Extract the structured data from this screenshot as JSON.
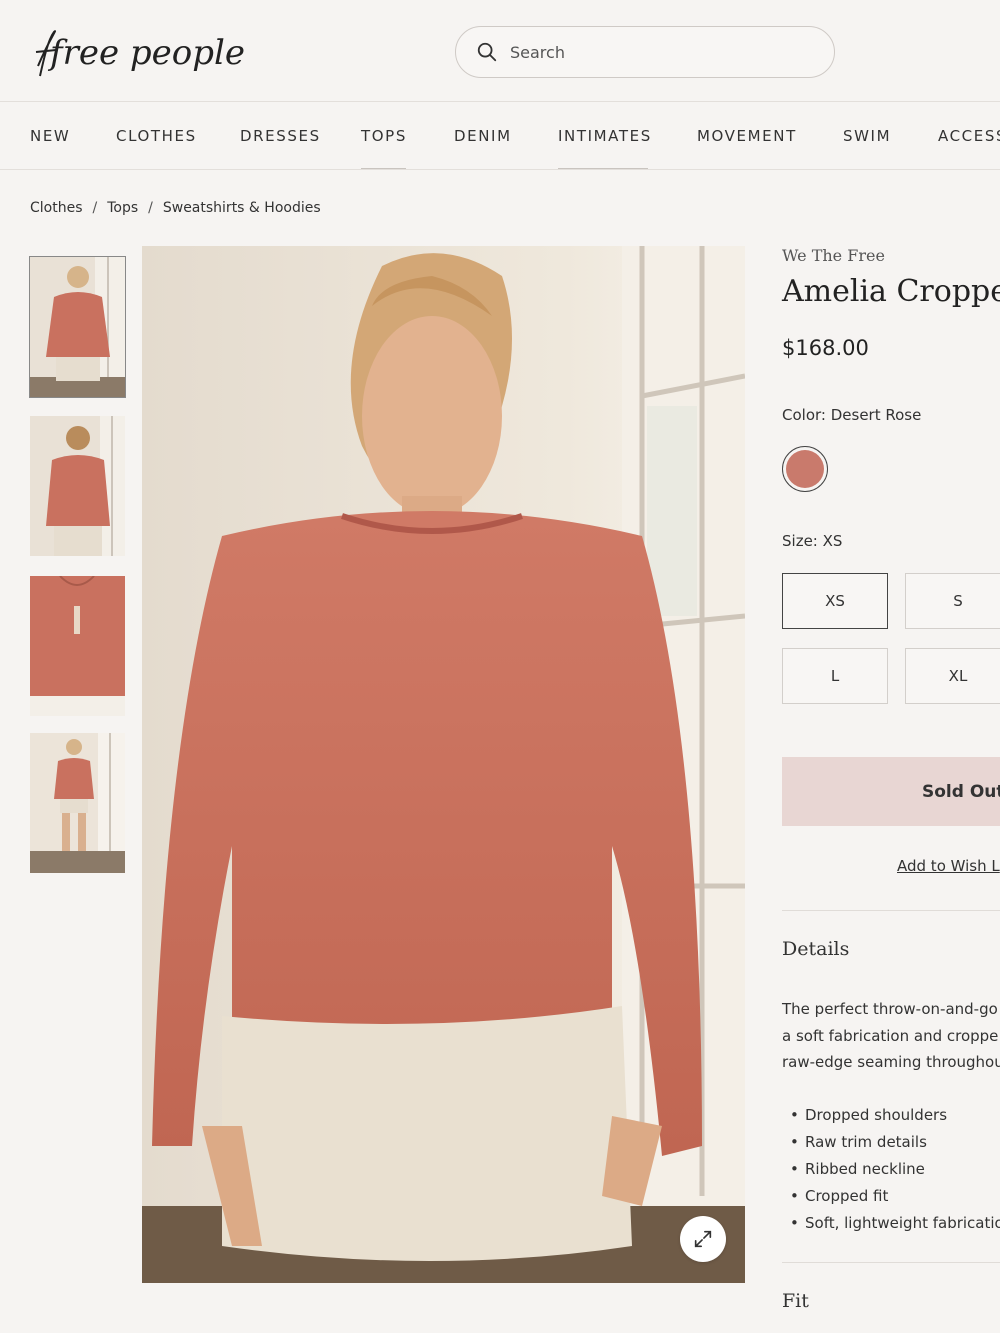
{
  "header": {
    "logo_text": "free people",
    "search_placeholder": "Search"
  },
  "nav": {
    "items": [
      "NEW",
      "CLOTHES",
      "DRESSES",
      "TOPS",
      "DENIM",
      "INTIMATES",
      "MOVEMENT",
      "SWIM",
      "ACCESS"
    ]
  },
  "breadcrumb": {
    "items": [
      "Clothes",
      "Tops",
      "Sweatshirts & Hoodies"
    ],
    "separator": "/"
  },
  "product": {
    "brand": "We The Free",
    "title": "Amelia Cropped",
    "price": "$168.00",
    "color_label": "Color: Desert Rose",
    "color_hex": "#c97a6c",
    "size_label": "Size: XS",
    "sizes": [
      "XS",
      "S",
      "L",
      "XL"
    ],
    "selected_size": "XS",
    "sold_out_label": "Sold Out",
    "wishlist_label": "Add to Wish L",
    "details_heading": "Details",
    "details_lines": [
      "The perfect throw-on-and-go",
      "a soft fabrication and croppe",
      "raw-edge seaming throughou"
    ],
    "details_bullets": [
      "Dropped shoulders",
      "Raw trim details",
      "Ribbed neckline",
      "Cropped fit",
      "Soft, lightweight fabricatio"
    ],
    "fit_heading": "Fit"
  },
  "colors": {
    "sweater": "#c9715f",
    "sold_out_bg": "#e8d6d3",
    "page_bg": "#f6f4f2"
  },
  "icons": {
    "search": "search-icon",
    "zoom": "expand-icon"
  }
}
